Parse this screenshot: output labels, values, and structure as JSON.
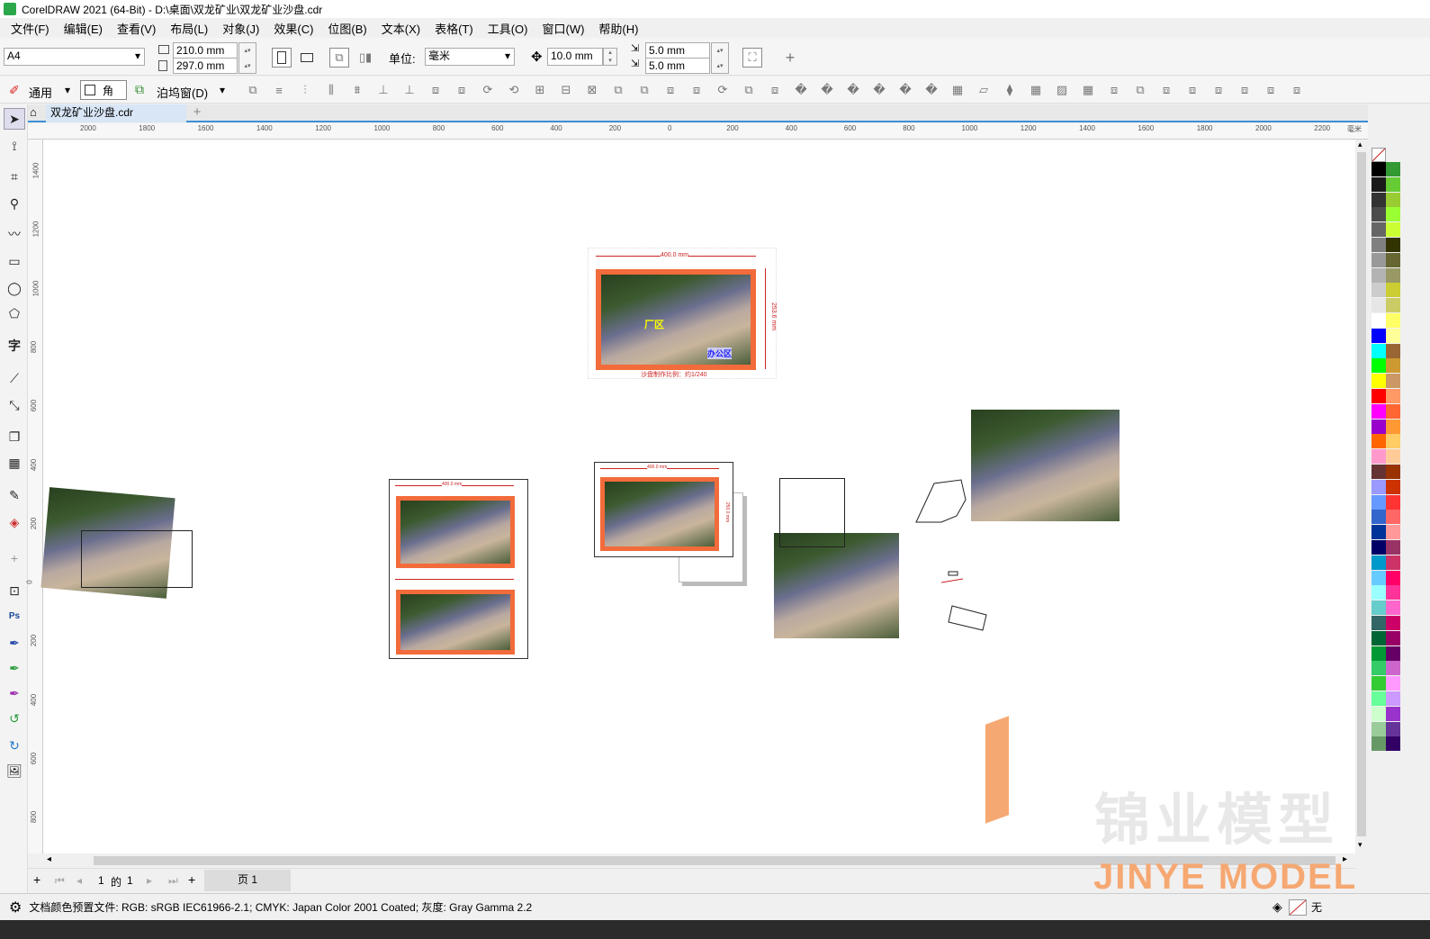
{
  "app": {
    "title": "CorelDRAW 2021 (64-Bit) - D:\\桌面\\双龙矿业\\双龙矿业沙盘.cdr"
  },
  "menu": [
    "文件(F)",
    "编辑(E)",
    "查看(V)",
    "布局(L)",
    "对象(J)",
    "效果(C)",
    "位图(B)",
    "文本(X)",
    "表格(T)",
    "工具(O)",
    "窗口(W)",
    "帮助(H)"
  ],
  "propbar": {
    "page_size": "A4",
    "width": "210.0 mm",
    "height": "297.0 mm",
    "unit_label": "单位:",
    "unit": "毫米",
    "nudge": "10.0 mm",
    "dup_x": "5.0 mm",
    "dup_y": "5.0 mm"
  },
  "toolbar2": {
    "mode": "通用",
    "corner": "角",
    "docker": "泊坞窗(D)"
  },
  "doc_tab": "双龙矿业沙盘.cdr",
  "ruler_h": [
    "2000",
    "1800",
    "1600",
    "1400",
    "1200",
    "1000",
    "800",
    "600",
    "400",
    "200",
    "0",
    "200",
    "400",
    "600",
    "800",
    "1000",
    "1200",
    "1400",
    "1600",
    "1800",
    "2000",
    "2200"
  ],
  "ruler_unit": "毫米",
  "ruler_v": [
    "1400",
    "1200",
    "1000",
    "800",
    "600",
    "400",
    "200",
    "0",
    "200",
    "400",
    "600",
    "800"
  ],
  "artwork": {
    "dim_top": "400.0 mm",
    "dim_side": "253.6 mm",
    "scale_note": "沙盘制作比例：约1/240",
    "label_factory": "厂区",
    "label_office": "办公区",
    "dim_small": "400.0 mm",
    "dim_small2": "250.0 mm"
  },
  "pager": {
    "current": "1",
    "of": "的",
    "total": "1",
    "page_tab": "页 1"
  },
  "status": {
    "color_profile": "文档颜色预置文件: RGB: sRGB IEC61966-2.1; CMYK: Japan Color 2001 Coated; 灰度: Gray Gamma 2.2",
    "fill": "无"
  },
  "watermark": {
    "cn": "锦业模型",
    "en": "JINYE MODEL"
  },
  "palette_colors": [
    "#000000",
    "#1a1a1a",
    "#333333",
    "#4d4d4d",
    "#666666",
    "#808080",
    "#999999",
    "#b3b3b3",
    "#cccccc",
    "#e6e6e6",
    "#ffffff",
    "#0000ff",
    "#00ffff",
    "#00ff00",
    "#ffff00",
    "#ff0000",
    "#ff00ff",
    "#9900cc",
    "#ff6600",
    "#ff99cc",
    "#663333",
    "#9999ff",
    "#6699ff",
    "#3366cc",
    "#003399",
    "#000066",
    "#0099cc",
    "#66ccff",
    "#99ffff",
    "#66cccc",
    "#336666",
    "#006633",
    "#009933",
    "#33cc66",
    "#33cc33",
    "#66ff99",
    "#ccffcc",
    "#99cc99",
    "#669966"
  ],
  "palette_colors2": [
    "#339933",
    "#66cc33",
    "#99cc33",
    "#99ff33",
    "#ccff33",
    "#333300",
    "#666633",
    "#999966",
    "#cccc33",
    "#cccc66",
    "#ffff66",
    "#ffff99",
    "#996633",
    "#cc9933",
    "#cc9966",
    "#ff9966",
    "#ff6633",
    "#ff9933",
    "#ffcc66",
    "#ffcc99",
    "#993300",
    "#cc3300",
    "#ff3333",
    "#ff6666",
    "#ff9999",
    "#993366",
    "#cc3366",
    "#ff0066",
    "#ff3399",
    "#ff66cc",
    "#cc0066",
    "#990066",
    "#660066",
    "#cc66cc",
    "#ff99ff",
    "#cc99ff",
    "#9933cc",
    "#663399",
    "#330066"
  ]
}
